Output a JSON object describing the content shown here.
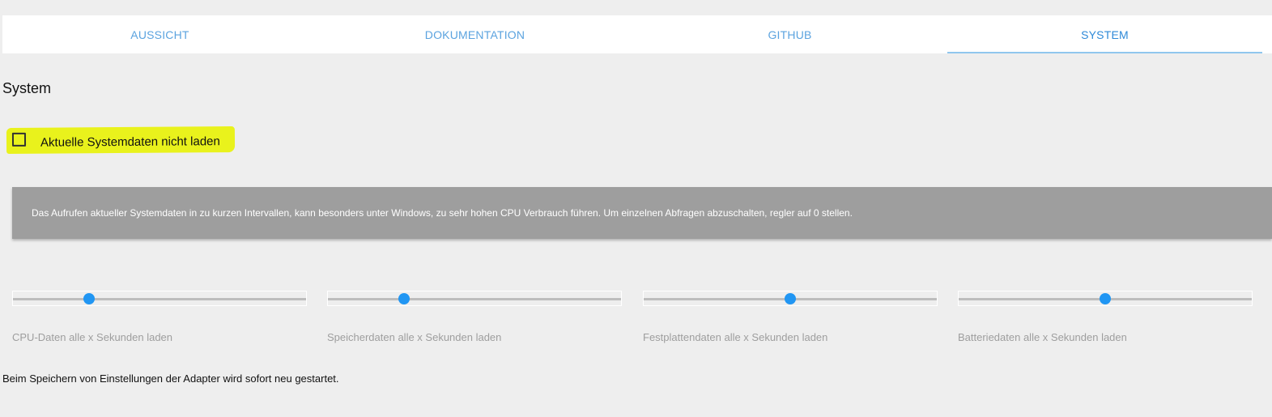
{
  "tabs": [
    {
      "label": "AUSSICHT",
      "active": false
    },
    {
      "label": "DOKUMENTATION",
      "active": false
    },
    {
      "label": "GITHUB",
      "active": false
    },
    {
      "label": "SYSTEM",
      "active": true
    }
  ],
  "page": {
    "title": "System"
  },
  "option": {
    "label": "Aktuelle Systemdaten nicht laden",
    "checked": false,
    "highlight_color": "#e9f21c"
  },
  "info": {
    "text": "Das Aufrufen aktueller Systemdaten in zu kurzen Intervallen, kann besonders unter Windows, zu sehr hohen CPU Verbrauch führen. Um einzelnen Abfragen abzuschalten, regler auf 0 stellen."
  },
  "sliders": [
    {
      "label": "CPU-Daten alle x Sekunden laden",
      "fraction": 0.26
    },
    {
      "label": "Speicherdaten alle x Sekunden laden",
      "fraction": 0.26
    },
    {
      "label": "Festplattendaten alle x Sekunden laden",
      "fraction": 0.5
    },
    {
      "label": "Batteriedaten alle x Sekunden laden",
      "fraction": 0.5
    }
  ],
  "footer": {
    "note": "Beim Speichern von Einstellungen der Adapter wird sofort neu gestartet."
  },
  "colors": {
    "accent": "#2196f3",
    "tab_text": "#5ba3df",
    "info_background": "#9e9e9e"
  }
}
